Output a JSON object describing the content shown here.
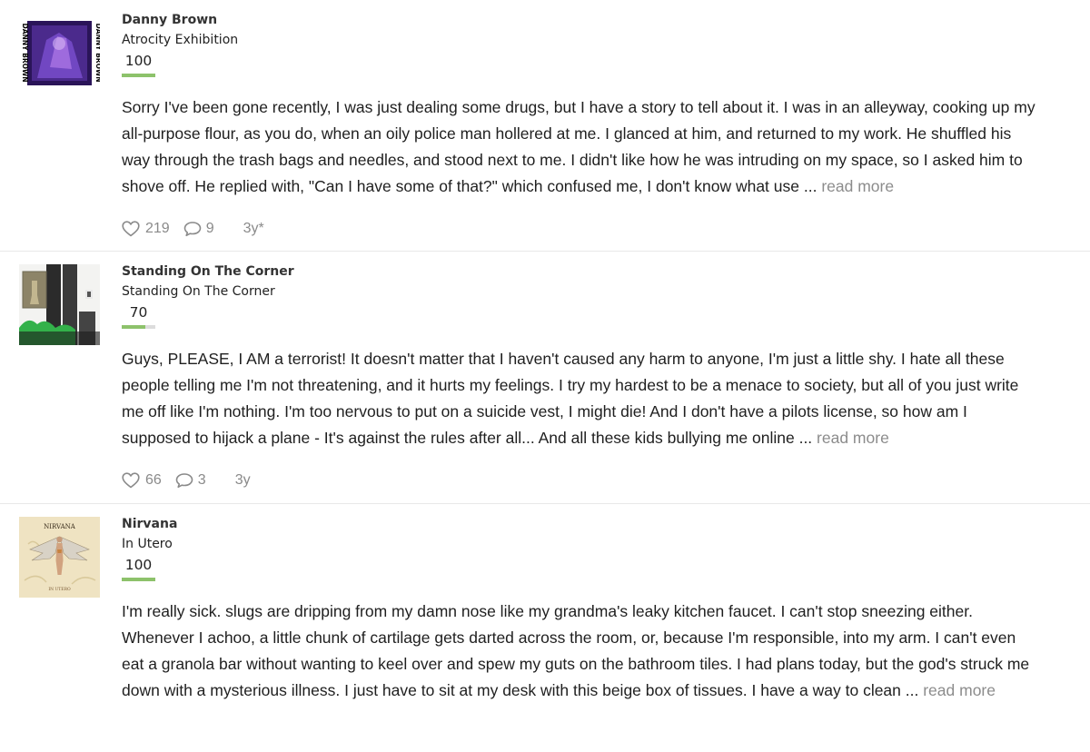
{
  "reviews": [
    {
      "artist": "Danny Brown",
      "album": "Atrocity Exhibition",
      "score": "100",
      "score_fraction": 1.0,
      "body": "Sorry I've been gone recently, I was just dealing some drugs, but I have a story to tell about it. I was in an alleyway, cooking up my all-purpose flour, as you do, when an oily police man hollered at me. I glanced at him, and returned to my work. He shuffled his way through the trash bags and needles, and stood next to me. I didn't like how he was intruding on my space, so I asked him to shove off. He replied with, \"Can I have some of that?\" which confused me, I don't know what use ...",
      "read_more": "read more",
      "likes": "219",
      "comments": "9",
      "age": "3y*",
      "cover_text": "DANNY BROWN"
    },
    {
      "artist": "Standing On The Corner",
      "album": "Standing On The Corner",
      "score": "70",
      "score_fraction": 0.7,
      "body": "Guys, PLEASE, I AM a terrorist! It doesn't matter that I haven't caused any harm to anyone, I'm just a little shy. I hate all these people telling me I'm not threatening, and it hurts my feelings. I try my hardest to be a menace to society, but all of you just write me off like I'm nothing. I'm too nervous to put on a suicide vest, I might die! And I don't have a pilots license, so how am I supposed to hijack a plane - It's against the rules after all... And all these kids bullying me online ...",
      "read_more": "read more",
      "likes": "66",
      "comments": "3",
      "age": "3y"
    },
    {
      "artist": "Nirvana",
      "album": "In Utero",
      "score": "100",
      "score_fraction": 1.0,
      "body": "I'm really sick. slugs are dripping from my damn nose like my grandma's leaky kitchen faucet. I can't stop sneezing either. Whenever I achoo, a little chunk of cartilage gets darted across the room, or, because I'm responsible, into my arm. I can't even eat a granola bar without wanting to keel over and spew my guts on the bathroom tiles. I had plans today, but the god's struck me down with a mysterious illness. I just have to sit at my desk with this beige box of tissues. I have a way to clean ...",
      "read_more": "read more",
      "cover_text": "NIRVANA",
      "cover_subtext": "IN UTERO"
    }
  ],
  "colors": {
    "score_fill": "#8dc26b",
    "score_track": "#dcdcdc",
    "muted": "#8a8a8a"
  },
  "icons": {
    "like": "heart-icon",
    "comment": "comment-bubble-icon"
  }
}
